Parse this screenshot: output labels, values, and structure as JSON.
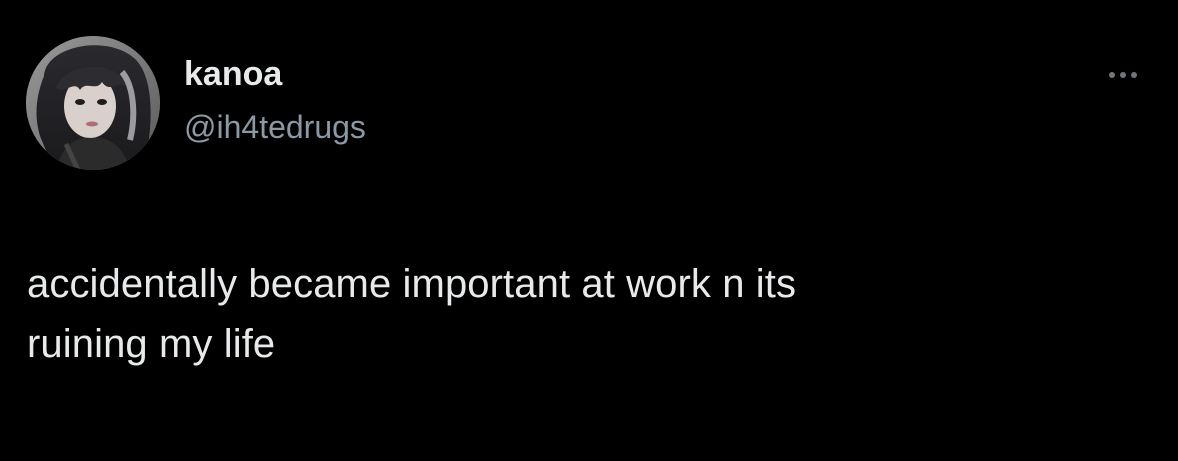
{
  "tweet": {
    "author": {
      "display_name": "kanoa",
      "handle": "@ih4tedrugs",
      "avatar_icon": "profile-photo"
    },
    "more_icon": "more-options-icon",
    "text_lines": [
      "accidentally became important at work n its",
      "ruining my life"
    ]
  },
  "colors": {
    "background": "#000000",
    "primary_text": "#e7e9ea",
    "secondary_text": "#8b98a5",
    "icon": "#71767b"
  }
}
